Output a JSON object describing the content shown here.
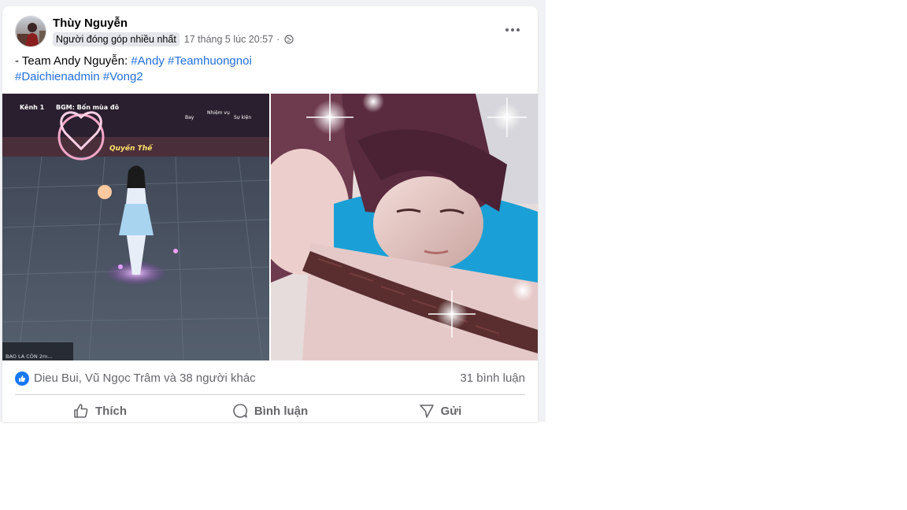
{
  "post": {
    "author": "Thùy Nguyễn",
    "badge": "Người đóng góp nhiều nhất",
    "timestamp": "17 tháng 5 lúc 20:57",
    "separator": "·",
    "audience_icon": "globe-icon",
    "text_line1_prefix": "- Team Andy Nguyễn: ",
    "hashtags_line1": [
      "#Andy",
      "#Teamhuongnoi"
    ],
    "hashtags_line2": [
      "#Daichienadmin",
      "#Vong2"
    ]
  },
  "photos": {
    "left": {
      "hud_channel": "Kênh 1",
      "hud_bgm": "BGM: Bốn mùa đô",
      "hud_name": "Quyền Thế",
      "hud_menu": [
        "Bay",
        "Nhiệm vụ",
        "Sự kiện"
      ],
      "hud_bottom": "BAO LA CÒN 2m..."
    }
  },
  "reactions": {
    "summary": "Dieu Bui, Vũ Ngọc Trâm và 38 người khác",
    "comments": "31 bình luận"
  },
  "actions": {
    "like": "Thích",
    "comment": "Bình luận",
    "share": "Gửi"
  },
  "colors": {
    "hashtag": "#216fdb",
    "like_blue": "#1877f2",
    "secondary_text": "#65676b"
  }
}
